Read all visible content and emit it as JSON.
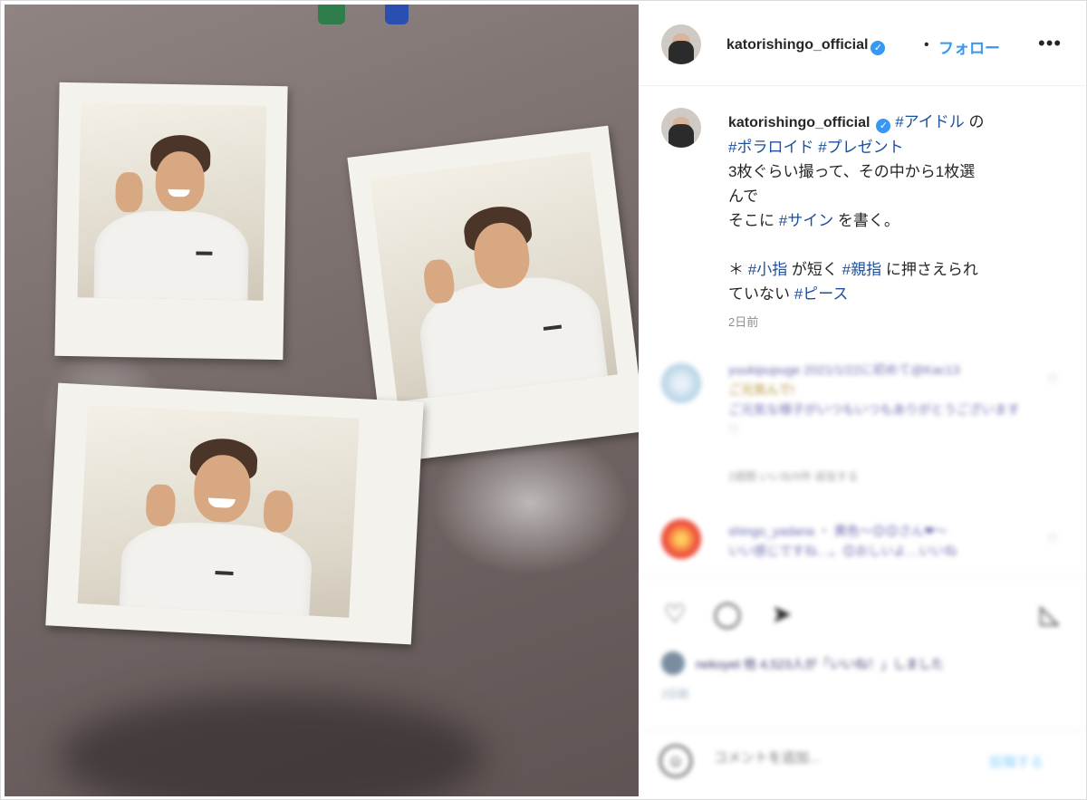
{
  "post": {
    "username": "katorishingo_official",
    "verified_icon": "verified-badge-icon",
    "separator": "•",
    "follow_label": "フォロー",
    "more_label": "•••"
  },
  "caption": {
    "username": "katorishingo_official",
    "line1_tag1": "#アイドル",
    "line1_text": " の",
    "line2_tag1": "#ポラロイド",
    "line2_tag2": "#プレゼント",
    "line3": "3枚ぐらい撮って、その中から1枚選",
    "line4": "んで",
    "line5_a": "そこに ",
    "line5_tag": "#サイン",
    "line5_b": " を書く。",
    "line6_a": "＊ ",
    "line6_tag1": "#小指",
    "line6_b": " が短く ",
    "line6_tag2": "#親指",
    "line6_c": " に押さえられ",
    "line7_a": "ていない ",
    "line7_tag": "#ピース",
    "time": "2日前"
  },
  "comments": [
    {
      "line1": "yuukipupuge 2021/1/22に初めて@Kac13",
      "line2": "ご元気んで!",
      "line3": "ご元気な様子がいつもいつもありがとうございます",
      "line4": "♡",
      "meta": "2週間  いいね!5件  返信する"
    },
    {
      "line1": "shingo_yadana ・ 黄色〜😊😊さん❤〜",
      "line2": "いい感じですね…。😊おしいよ…いいね"
    }
  ],
  "actions": {
    "like_icon": "heart-icon",
    "comment_icon": "comment-icon",
    "share_icon": "share-icon",
    "save_icon": "bookmark-icon"
  },
  "liked_by": {
    "text": "nekoyet 他 4,523人が「いいね！」しました",
    "sub": "2日前"
  },
  "add_comment": {
    "emoji_icon": "emoji-icon",
    "placeholder": "コメントを追加...",
    "post_label": "投稿する"
  },
  "colors": {
    "link": "#3897f0",
    "hashtag": "#1e4f9a",
    "muted": "#8e8e8e"
  }
}
